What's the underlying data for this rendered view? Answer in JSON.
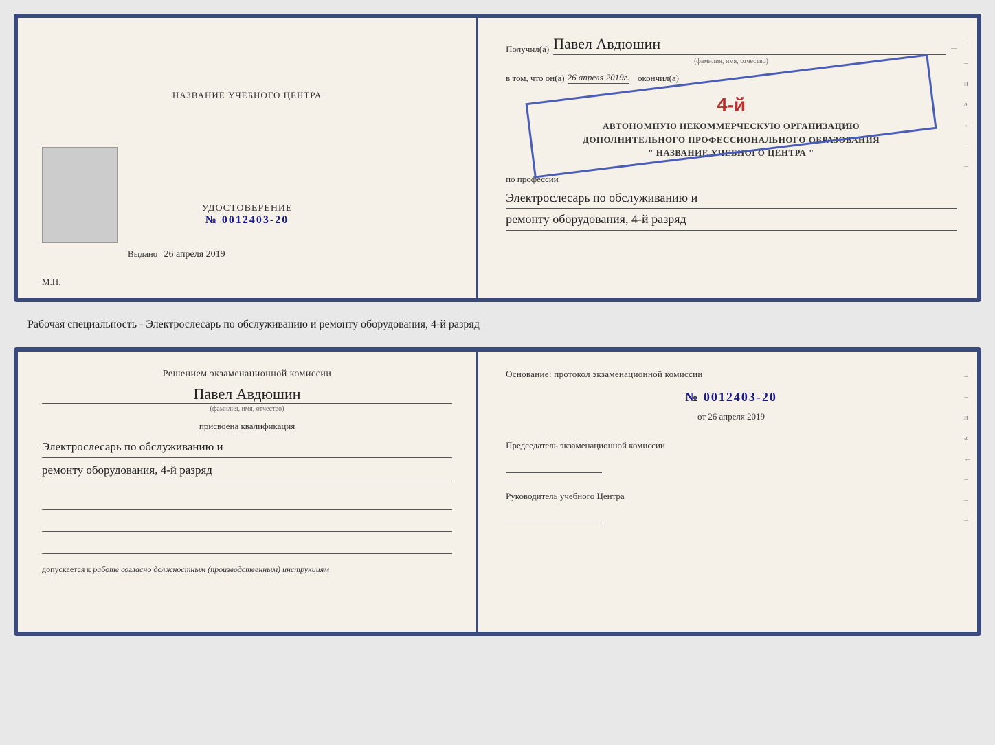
{
  "top_left": {
    "title": "НАЗВАНИЕ УЧЕБНОГО ЦЕНТРА",
    "udostoverenie": "УДОСТОВЕРЕНИЕ",
    "number_prefix": "№",
    "number": "0012403-20",
    "vydano_label": "Выдано",
    "vydano_date": "26 апреля 2019",
    "mp": "М.П."
  },
  "top_right": {
    "poluchil_label": "Получил(a)",
    "name": "Павел Авдюшин",
    "fio_hint": "(фамилия, имя, отчество)",
    "vtom_label": "в том, что он(а)",
    "date": "26 апреля 2019г.",
    "okonchil_label": "окончил(а)",
    "stamp_line1": "АВТОНОМНУЮ НЕКОММЕРЧЕСКУЮ ОРГАНИЗАЦИЮ",
    "stamp_line2": "ДОПОЛНИТЕЛЬНОГО ПРОФЕССИОНАЛЬНОГО ОБРАЗОВАНИЯ",
    "stamp_line3": "\" НАЗВАНИЕ УЧЕБНОГО ЦЕНТРА \"",
    "rank_prefix": "4-й",
    "po_professii": "по профессии",
    "profession_line1": "Электрослесарь по обслуживанию и",
    "profession_line2": "ремонту оборудования, 4-й разряд"
  },
  "middle": {
    "text": "Рабочая специальность - Электрослесарь по обслуживанию и ремонту оборудования, 4-й разряд"
  },
  "bottom_left": {
    "resheniem_title": "Решением экзаменационной комиссии",
    "name": "Павел Авдюшин",
    "fio_hint": "(фамилия, имя, отчество)",
    "prisvoena": "присвоена квалификация",
    "qualification_line1": "Электрослесарь по обслуживанию и",
    "qualification_line2": "ремонту оборудования, 4-й разряд",
    "dopuskaetsya_label": "допускается к",
    "dopuskaetsya_value": "работе согласно должностным (производственным) инструкциям"
  },
  "bottom_right": {
    "osnovanie_title": "Основание: протокол экзаменационной комиссии",
    "number_prefix": "№",
    "number": "0012403-20",
    "ot_prefix": "от",
    "ot_date": "26 апреля 2019",
    "predsedatel_label": "Председатель экзаменационной комиссии",
    "rukovoditel_label": "Руководитель учебного Центра"
  },
  "edge_marks": {
    "items": [
      "и",
      "а",
      "←",
      "–",
      "–",
      "–",
      "–"
    ]
  }
}
